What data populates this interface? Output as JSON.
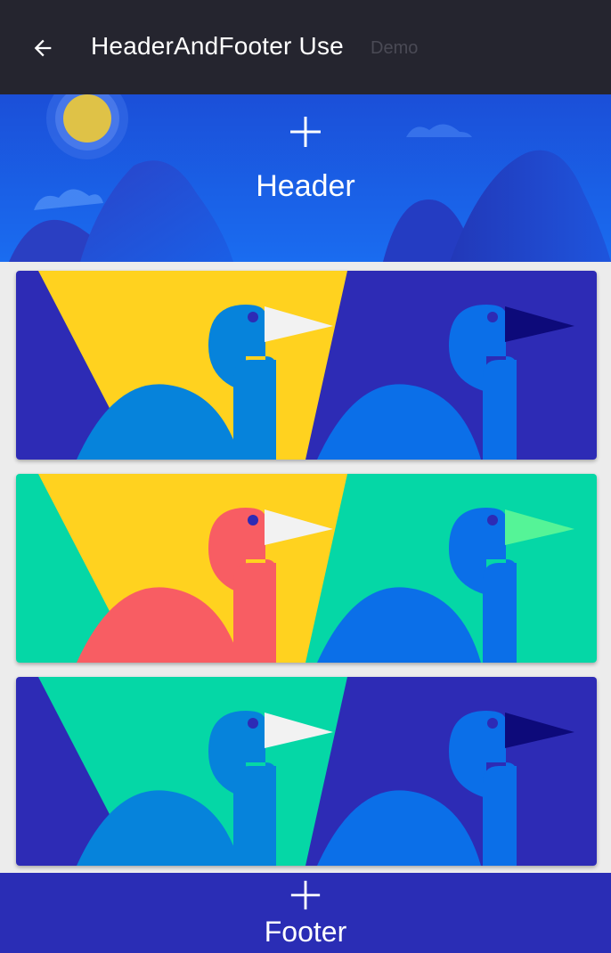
{
  "app_bar": {
    "title": "HeaderAndFooter Use",
    "subtitle": "Demo"
  },
  "header": {
    "label": "Header"
  },
  "footer": {
    "label": "Footer"
  },
  "list": {
    "items": [
      {
        "scheme": "blue-yellow",
        "colors": {
          "bg": "#2d2bb5",
          "light": "#ffd21f",
          "bird_left": "#0683db",
          "bird_right": "#0b6fe8",
          "beak_left": "#f2f2f2",
          "beak_right": "#0d0a7a"
        }
      },
      {
        "scheme": "green-yellow",
        "colors": {
          "bg": "#05d7a6",
          "light": "#ffd21f",
          "bird_left": "#f85d63",
          "bird_right": "#0b6fe8",
          "beak_left": "#f2f2f2",
          "beak_right": "#55f497"
        }
      },
      {
        "scheme": "blue-green",
        "colors": {
          "bg": "#2d2bb5",
          "light": "#05d7a6",
          "bird_left": "#0683db",
          "bird_right": "#0b6fe8",
          "beak_left": "#f2f2f2",
          "beak_right": "#0d0a7a"
        }
      }
    ]
  },
  "colors": {
    "top_bar": "#25252f",
    "header_sky": "#1a5de6",
    "footer": "#2a2db5",
    "sun": "#dfc247"
  }
}
